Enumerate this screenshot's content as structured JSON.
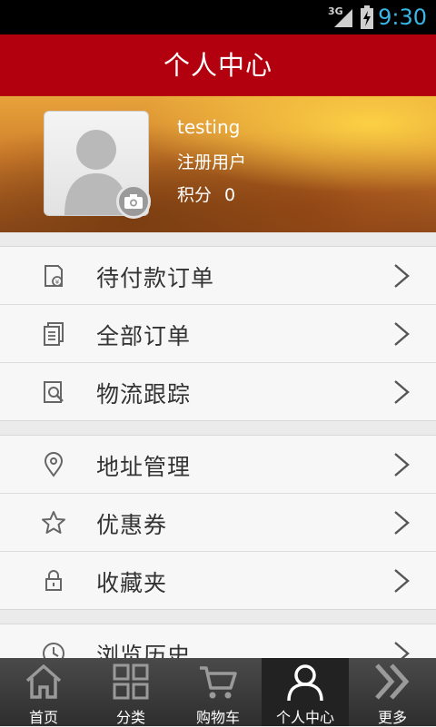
{
  "status_bar": {
    "network": "3G",
    "time": "9:30"
  },
  "header": {
    "title": "个人中心"
  },
  "profile": {
    "username": "testing",
    "role": "注册用户",
    "points_label": "积分",
    "points_value": "0"
  },
  "menu": {
    "group1": [
      {
        "label": "待付款订单",
        "icon": "pending-payment-icon"
      },
      {
        "label": "全部订单",
        "icon": "orders-icon"
      },
      {
        "label": "物流跟踪",
        "icon": "logistics-icon"
      }
    ],
    "group2": [
      {
        "label": "地址管理",
        "icon": "location-icon"
      },
      {
        "label": "优惠券",
        "icon": "star-icon"
      },
      {
        "label": "收藏夹",
        "icon": "lock-icon"
      }
    ],
    "group3": [
      {
        "label": "浏览历史",
        "icon": "history-icon"
      }
    ]
  },
  "tabbar": {
    "tabs": [
      {
        "label": "首页",
        "icon": "home-icon"
      },
      {
        "label": "分类",
        "icon": "category-grid-icon"
      },
      {
        "label": "购物车",
        "icon": "cart-icon"
      },
      {
        "label": "个人中心",
        "icon": "user-icon",
        "active": true
      },
      {
        "label": "更多",
        "icon": "more-chevrons-icon"
      }
    ]
  },
  "colors": {
    "header_red": "#b2000e",
    "status_blue": "#39b5e6"
  }
}
